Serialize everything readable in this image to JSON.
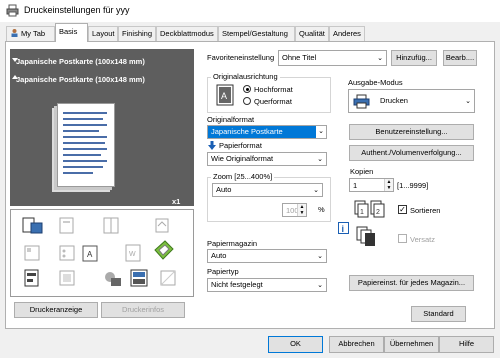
{
  "window": {
    "title": "Druckeinstellungen für yyy"
  },
  "tabs": [
    {
      "label": "My Tab"
    },
    {
      "label": "Basis"
    },
    {
      "label": "Layout"
    },
    {
      "label": "Finishing"
    },
    {
      "label": "Deckblattmodus"
    },
    {
      "label": "Stempel/Gestaltung"
    },
    {
      "label": "Qualität"
    },
    {
      "label": "Anderes"
    }
  ],
  "active_tab": "Basis",
  "preview": {
    "paper_label_1": "Japanische Postkarte (100x148 mm)",
    "paper_label_2": "Japanische Postkarte (100x148 mm)",
    "copies_badge": "x1"
  },
  "left_buttons": {
    "printer_display": "Druckeranzeige",
    "printer_info": "Druckerinfos"
  },
  "favorites": {
    "label": "Favoriteneinstellung",
    "value": "Ohne Titel",
    "add_button": "Hinzufüg...",
    "edit_button": "Bearb...."
  },
  "orientation": {
    "group_label": "Originalausrichtung",
    "portrait": "Hochformat",
    "landscape": "Querformat",
    "selected": "Hochformat"
  },
  "original_size": {
    "label": "Originalformat",
    "value": "Japanische Postkarte"
  },
  "paper_size": {
    "label": "Papierformat",
    "value": "Wie Originalformat"
  },
  "zoom": {
    "group_label": "Zoom [25...400%]",
    "value": "Auto",
    "percent_value": "100",
    "percent_sign": "%"
  },
  "paper_tray": {
    "label": "Papiermagazin",
    "value": "Auto"
  },
  "paper_type": {
    "label": "Papiertyp",
    "value": "Nicht festgelegt"
  },
  "output": {
    "label": "Ausgabe-Modus",
    "value": "Drucken"
  },
  "user_settings_button": "Benutzereinstellung...",
  "auth_button": "Authent./Volumenverfolgung...",
  "copies": {
    "label": "Kopien",
    "value": "1",
    "range": "[1...9999]"
  },
  "collate": {
    "label": "Sortieren",
    "checked": true
  },
  "offset": {
    "label": "Versatz",
    "checked": false,
    "enabled": false
  },
  "paper_settings_button": "Papiereinst. für jedes Magazin...",
  "standard_button": "Standard",
  "footer": {
    "ok": "OK",
    "cancel": "Abbrechen",
    "apply": "Übernehmen",
    "help": "Hilfe"
  }
}
